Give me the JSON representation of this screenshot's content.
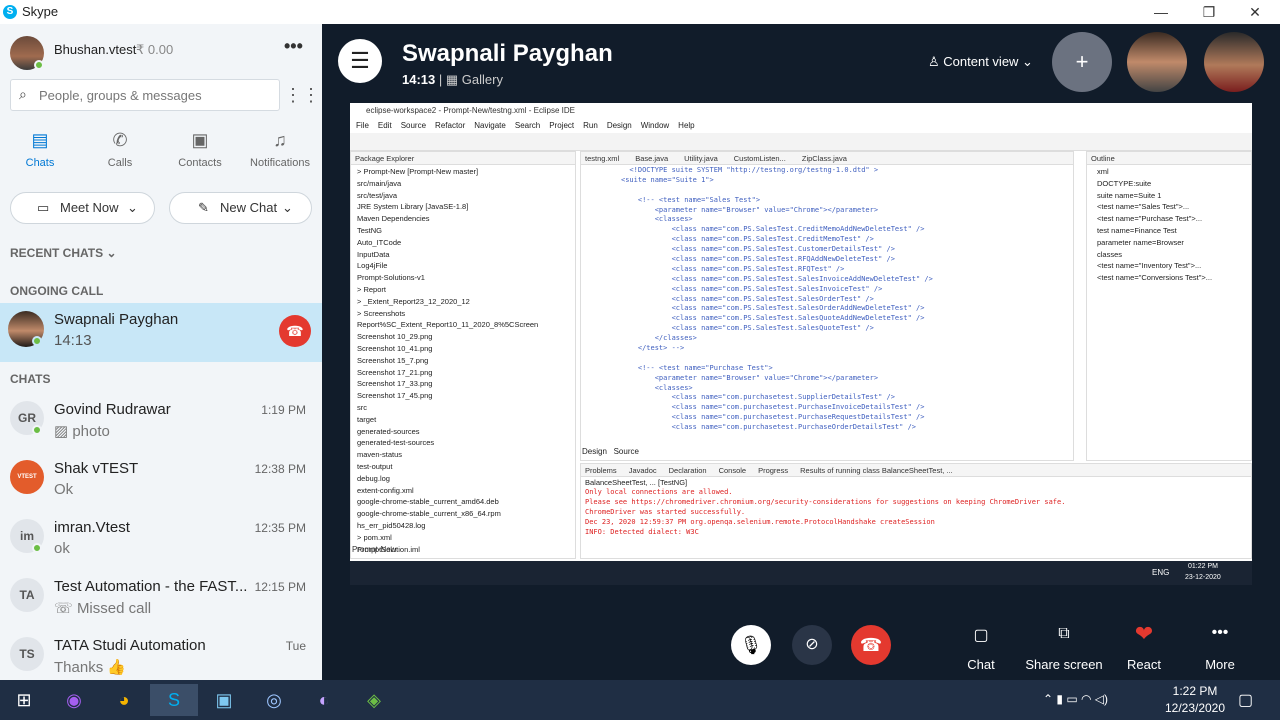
{
  "app": {
    "title": "Skype"
  },
  "profile": {
    "name": "Bhushan.vtest",
    "credit": "₹ 0.00"
  },
  "search": {
    "placeholder": "People, groups & messages"
  },
  "nav": [
    {
      "label": "Chats",
      "icon": "chat-icon"
    },
    {
      "label": "Calls",
      "icon": "phone-icon"
    },
    {
      "label": "Contacts",
      "icon": "contacts-icon"
    },
    {
      "label": "Notifications",
      "icon": "bell-icon"
    }
  ],
  "buttons": {
    "meet_now": "Meet Now",
    "new_chat": "New Chat"
  },
  "sections": {
    "recent": "RECENT CHATS",
    "ongoing": "ONGOING CALL",
    "chats": "CHATS"
  },
  "ongoing_call": {
    "name": "Swapnali Payghan",
    "duration": "14:13"
  },
  "chats": [
    {
      "initials": "GR",
      "name": "Govind Rudrawar",
      "preview": "photo",
      "time": "1:19 PM"
    },
    {
      "initials": "",
      "name": "Shak vTEST",
      "preview": "Ok",
      "time": "12:38 PM"
    },
    {
      "initials": "im",
      "name": "imran.Vtest",
      "preview": "ok",
      "time": "12:35 PM"
    },
    {
      "initials": "TA",
      "name": "Test Automation - the FAST...",
      "preview": "Missed call",
      "time": "12:15 PM"
    },
    {
      "initials": "TS",
      "name": "TATA Studi Automation",
      "preview": "Thanks 👍",
      "time": "Tue"
    }
  ],
  "call": {
    "title": "Swapnali Payghan",
    "duration": "14:13",
    "layout": "Gallery",
    "content_view": "Content view",
    "actions": [
      {
        "label": "Chat"
      },
      {
        "label": "Share screen"
      },
      {
        "label": "React"
      },
      {
        "label": "More"
      }
    ]
  },
  "eclipse": {
    "title": "eclipse-workspace2 - Prompt-New/testng.xml - Eclipse IDE",
    "menu": [
      "File",
      "Edit",
      "Source",
      "Refactor",
      "Navigate",
      "Search",
      "Project",
      "Run",
      "Design",
      "Window",
      "Help"
    ],
    "package_explorer": "Package Explorer",
    "tree": [
      "> Prompt-New [Prompt-New master]",
      "src/main/java",
      "src/test/java",
      "JRE System Library [JavaSE-1.8]",
      "Maven Dependencies",
      "TestNG",
      "Auto_ITCode",
      "InputData",
      "Log4jFile",
      "Prompt-Solutions-v1",
      "> Report",
      "> _Extent_Report23_12_2020_12",
      "> Screenshots",
      "Report%SC_Extent_Report10_11_2020_8%5CScreen",
      "Screenshot 10_29.png",
      "Screenshot 10_41.png",
      "Screenshot 15_7.png",
      "Screenshot 17_21.png",
      "Screenshot 17_33.png",
      "Screenshot 17_45.png",
      "src",
      "target",
      "generated-sources",
      "generated-test-sources",
      "maven-status",
      "test-output",
      "debug.log",
      "extent-config.xml",
      "google-chrome-stable_current_amd64.deb",
      "google-chrome-stable_current_x86_64.rpm",
      "hs_err_pid50428.log",
      "> pom.xml",
      "PromptSolution.iml"
    ],
    "tabs": [
      "testng.xml",
      "Base.java",
      "Utility.java",
      "CustomListen...",
      "ZipClass.java"
    ],
    "code": [
      "  <!DOCTYPE suite SYSTEM \"http://testng.org/testng-1.0.dtd\" >",
      "<suite name=\"Suite 1\">",
      "",
      "    <!-- <test name=\"Sales Test\">",
      "        <parameter name=\"Browser\" value=\"Chrome\"></parameter>",
      "        <classes>",
      "            <class name=\"com.PS.SalesTest.CreditMemoAddNewDeleteTest\" />",
      "            <class name=\"com.PS.SalesTest.CreditMemoTest\" />",
      "            <class name=\"com.PS.SalesTest.CustomerDetailsTest\" />",
      "            <class name=\"com.PS.SalesTest.RFQAddNewDeleteTest\" />",
      "            <class name=\"com.PS.SalesTest.RFQTest\" />",
      "            <class name=\"com.PS.SalesTest.SalesInvoiceAddNewDeleteTest\" />",
      "            <class name=\"com.PS.SalesTest.SalesInvoiceTest\" />",
      "            <class name=\"com.PS.SalesTest.SalesOrderTest\" />",
      "            <class name=\"com.PS.SalesTest.SalesOrderAddNewDeleteTest\" />",
      "            <class name=\"com.PS.SalesTest.SalesQuoteAddNewDeleteTest\" />",
      "            <class name=\"com.PS.SalesTest.SalesQuoteTest\" />",
      "        </classes>",
      "    </test> -->",
      "",
      "    <!-- <test name=\"Purchase Test\">",
      "        <parameter name=\"Browser\" value=\"Chrome\"></parameter>",
      "        <classes>",
      "            <class name=\"com.purchasetest.SupplierDetailsTest\" />",
      "            <class name=\"com.purchasetest.PurchaseInvoiceDetailsTest\" />",
      "            <class name=\"com.purchasetest.PurchaseRequestDetailsTest\" />",
      "            <class name=\"com.purchasetest.PurchaseOrderDetailsTest\" />"
    ],
    "outline": "Outline",
    "outline_items": [
      "xml",
      "DOCTYPE:suite",
      "suite name=Suite 1",
      "<test name=\"Sales Test\">...",
      "<test name=\"Purchase Test\">...",
      "test name=Finance Test",
      "parameter name=Browser",
      "classes",
      "<test name=\"Inventory Test\">...",
      "<test name=\"Conversions Test\">..."
    ],
    "bottom_tabs": [
      "Design",
      "Source"
    ],
    "console_tabs": [
      "Problems",
      "Javadoc",
      "Declaration",
      "Console",
      "Progress",
      "Results of running class BalanceSheetTest, ..."
    ],
    "console_header": "BalanceSheetTest, ... [TestNG]",
    "console": [
      "Only local connections are allowed.",
      "Please see https://chromedriver.chromium.org/security-considerations for suggestions on keeping ChromeDriver safe.",
      "ChromeDriver was started successfully.",
      "Dec 23, 2020 12:59:37 PM org.openqa.selenium.remote.ProtocolHandshake createSession",
      "INFO: Detected dialect: W3C"
    ],
    "status": "Prompt-New",
    "tray_lang": "ENG",
    "tray_time": "01:22 PM",
    "tray_date": "23-12-2020"
  },
  "taskbar": {
    "time": "1:22 PM",
    "date": "12/23/2020"
  }
}
